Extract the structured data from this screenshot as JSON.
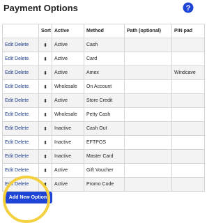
{
  "page": {
    "title": "Payment Options",
    "help_icon": "question-circle-icon",
    "help_color": "#1f45d6"
  },
  "table": {
    "headers": [
      "",
      "Sort",
      "Active",
      "Method",
      "Path (optional)",
      "PIN pad"
    ],
    "rows": [
      {
        "edit": "Edit",
        "delete": "Delete",
        "sort": "⬍",
        "active": "Active",
        "method": "Cash",
        "path": "",
        "pinpad": ""
      },
      {
        "edit": "Edit",
        "delete": "Delete",
        "sort": "⬍",
        "active": "Active",
        "method": "Card",
        "path": "",
        "pinpad": ""
      },
      {
        "edit": "Edit",
        "delete": "Delete",
        "sort": "⬍",
        "active": "Active",
        "method": "Amex",
        "path": "",
        "pinpad": "Windcave"
      },
      {
        "edit": "Edit",
        "delete": "Delete",
        "sort": "⬍",
        "active": "Wholesale",
        "method": "On Account",
        "path": "",
        "pinpad": ""
      },
      {
        "edit": "Edit",
        "delete": "Delete",
        "sort": "⬍",
        "active": "Active",
        "method": "Store Credit",
        "path": "",
        "pinpad": ""
      },
      {
        "edit": "Edit",
        "delete": "Delete",
        "sort": "⬍",
        "active": "Wholesale",
        "method": "Petty Cash",
        "path": "",
        "pinpad": ""
      },
      {
        "edit": "Edit",
        "delete": "Delete",
        "sort": "⬍",
        "active": "Inactive",
        "method": "Cash Out",
        "path": "",
        "pinpad": ""
      },
      {
        "edit": "Edit",
        "delete": "Delete",
        "sort": "⬍",
        "active": "Inactive",
        "method": "EFTPOS",
        "path": "",
        "pinpad": ""
      },
      {
        "edit": "Edit",
        "delete": "Delete",
        "sort": "⬍",
        "active": "Inactive",
        "method": "Master Card",
        "path": "",
        "pinpad": ""
      },
      {
        "edit": "Edit",
        "delete": "Delete",
        "sort": "⬍",
        "active": "Active",
        "method": "Gift Voucher",
        "path": "",
        "pinpad": ""
      },
      {
        "edit": "Edit",
        "delete": "Delete",
        "sort": "⬍",
        "active": "Active",
        "method": "Promo Code",
        "path": "",
        "pinpad": ""
      }
    ]
  },
  "actions": {
    "add_label": "Add New Option",
    "button_color": "#1f45d6",
    "highlight_color": "#f4d03f"
  }
}
